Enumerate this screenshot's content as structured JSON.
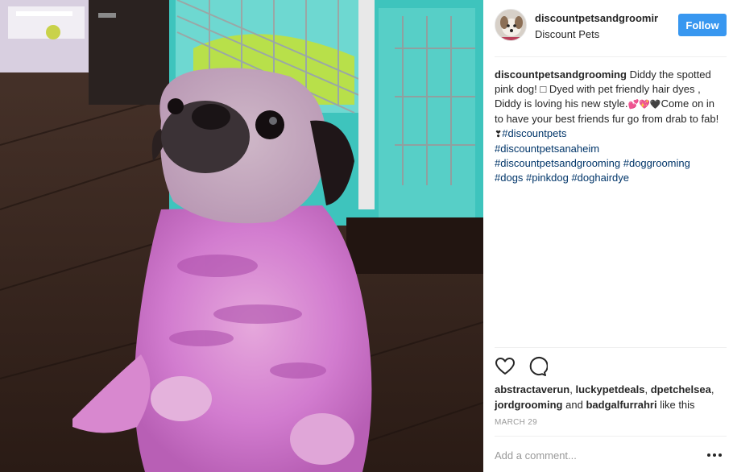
{
  "post": {
    "username": "discountpetsandgroomir",
    "location": "Discount Pets",
    "follow_label": "Follow"
  },
  "caption": {
    "username": "discountpetsandgrooming",
    "text_1": " Diddy the spotted pink dog! □ Dyed with pet friendly hair dyes , Diddy is loving his new style.",
    "emojis": "💕💖🖤",
    "text_2": "Come on in to have your best friends fur go from drab to fab! ",
    "emoji_2": "❣",
    "tags": [
      "#discountpets",
      "#discountpetsanaheim",
      "#discountpetsandgrooming",
      "#doggrooming",
      "#dogs",
      "#pinkdog",
      "#doghairdye"
    ]
  },
  "actions": {
    "like_icon": "heart-icon",
    "comment_icon": "comment-icon"
  },
  "likes": {
    "users": [
      "abstractaverun",
      "luckypetdeals",
      "dpetchelsea",
      "jordgrooming",
      "badgalfurrahri"
    ],
    "and_label": "and",
    "suffix": "like this"
  },
  "date": "MARCH 29",
  "comment": {
    "placeholder": "Add a comment...",
    "more_icon": "more-options-icon"
  },
  "colors": {
    "follow_blue": "#3897f0",
    "hashtag": "#003569",
    "muted": "#999999"
  }
}
